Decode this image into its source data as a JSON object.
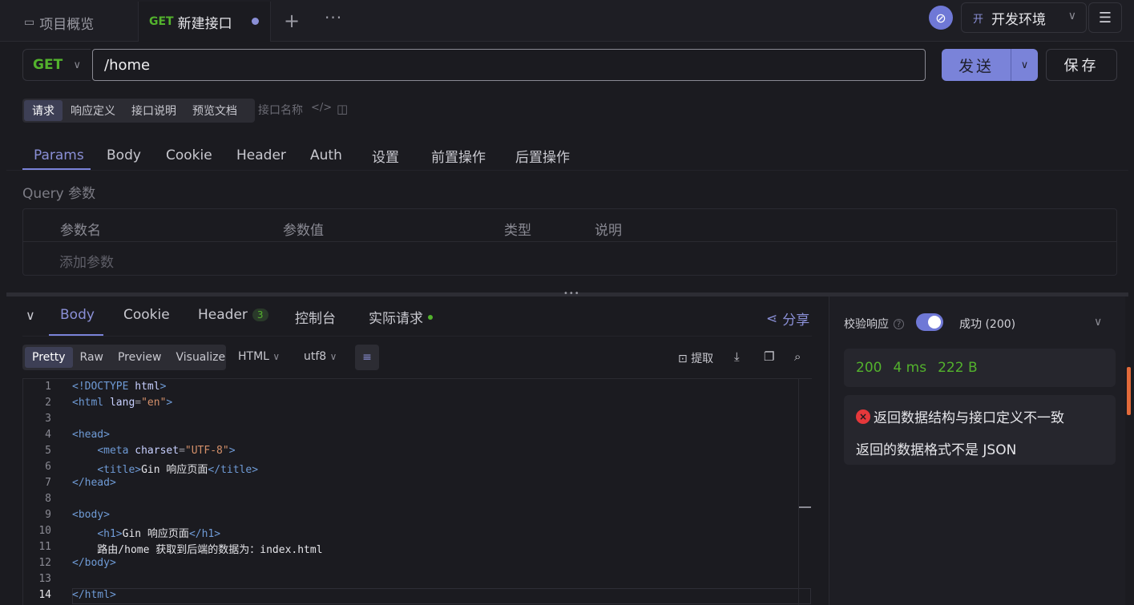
{
  "tabs": {
    "overview": "项目概览",
    "new_method": "GET",
    "new_title": "新建接口",
    "add": "+",
    "more": "···"
  },
  "env": {
    "badge": "开",
    "name": "开发环境"
  },
  "request": {
    "method": "GET",
    "url": "/home",
    "send": "发送",
    "save": "保存"
  },
  "segments": [
    "请求",
    "响应定义",
    "接口说明",
    "预览文档"
  ],
  "api_name_placeholder": "接口名称",
  "req_tabs": [
    "Params",
    "Body",
    "Cookie",
    "Header",
    "Auth",
    "设置",
    "前置操作",
    "后置操作"
  ],
  "query": {
    "label": "Query 参数",
    "columns": [
      "参数名",
      "参数值",
      "类型",
      "说明"
    ],
    "add": "添加参数"
  },
  "response": {
    "tabs": [
      "Body",
      "Cookie",
      "Header",
      "控制台",
      "实际请求"
    ],
    "header_count": "3",
    "share": "分享",
    "formats": [
      "Pretty",
      "Raw",
      "Preview",
      "Visualize"
    ],
    "lang": "HTML",
    "charset": "utf8",
    "extract": "提取",
    "lines": [
      "1",
      "2",
      "3",
      "4",
      "5",
      "6",
      "7",
      "8",
      "9",
      "10",
      "11",
      "12",
      "13",
      "14"
    ]
  },
  "side": {
    "validate": "校验响应",
    "status_label": "成功 (200)",
    "status": "200",
    "time": "4 ms",
    "size": "222 B",
    "error_title": "返回数据结构与接口定义不一致",
    "error_detail": "返回的数据格式不是 JSON"
  },
  "colors": {
    "accent": "#7a83d9",
    "method_get": "#53b22d",
    "error": "#e5383b"
  }
}
